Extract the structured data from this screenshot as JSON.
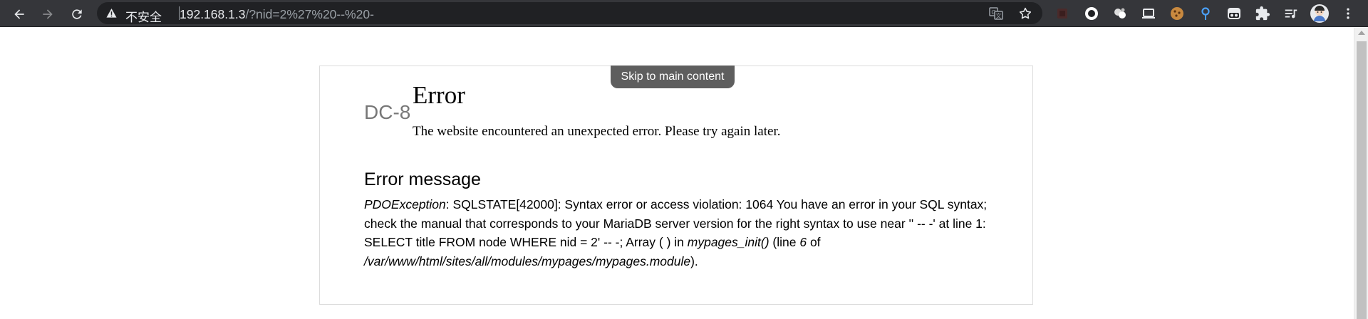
{
  "browser": {
    "security_label": "不安全",
    "url_host": "192.168.1.3",
    "url_path": "/?nid=2%27%20--%20-"
  },
  "page": {
    "skip_link": "Skip to main content",
    "site_name": "DC-8",
    "title": "Error",
    "subtitle": "The website encountered an unexpected error. Please try again later.",
    "message_heading": "Error message",
    "message": {
      "exception": "PDOException",
      "text1": ": SQLSTATE[42000]: Syntax error or access violation: 1064 You have an error in your SQL syntax; check the manual that corresponds to your MariaDB server version for the right syntax to use near '' -- -' at line 1: SELECT title FROM node WHERE nid = 2' -- -; Array ( ) in ",
      "function": "mypages_init()",
      "text2": " (line ",
      "line": "6",
      "text3": " of ",
      "file": "/var/www/html/sites/all/modules/mypages/mypages.module",
      "text4": ")."
    }
  }
}
